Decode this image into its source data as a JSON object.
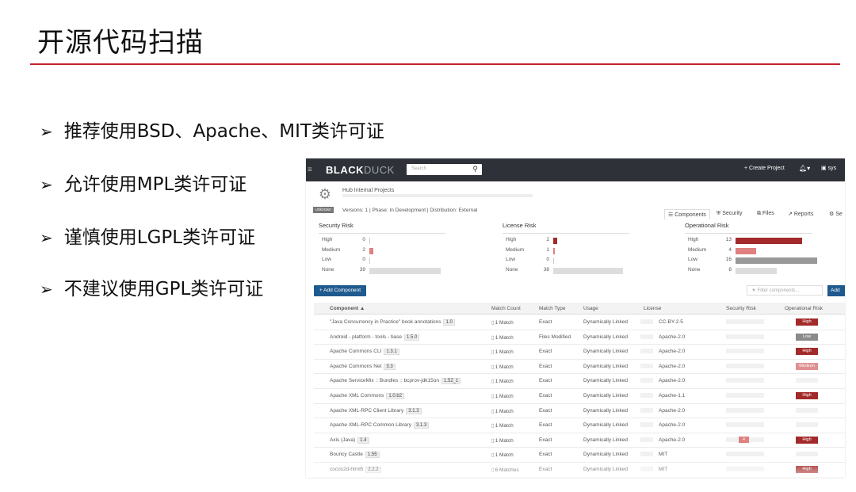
{
  "slide": {
    "title": "开源代码扫描",
    "bullets": [
      {
        "marker": "➢",
        "text": "推荐使用BSD、Apache、MIT类许可证"
      },
      {
        "marker": "➢",
        "text": "允许使用MPL类许可证"
      },
      {
        "marker": "➢",
        "text": "谨慎使用LGPL类许可证"
      },
      {
        "marker": "➢",
        "text": "不建议使用GPL类许可证"
      }
    ],
    "accent_color": "#c8202c"
  },
  "app": {
    "logo_black": "BLACK",
    "logo_duck": "DUCK",
    "search_placeholder": "Search",
    "create_project": "+ Create Project",
    "user": "sys",
    "project": {
      "name": "Hub Internal Projects",
      "badge": "unknown",
      "meta": "Versions: 1  |  Phase: In Development  |  Distribution: External"
    },
    "tabs": [
      "Components",
      "Security",
      "Files",
      "Reports",
      "Se"
    ],
    "risk_panels": [
      {
        "title": "Security Risk",
        "rows": [
          {
            "label": "High",
            "count": 0,
            "color": "#a32a2a"
          },
          {
            "label": "Medium",
            "count": 2,
            "color": "#e08080"
          },
          {
            "label": "Low",
            "count": 0,
            "color": "#999999"
          },
          {
            "label": "None",
            "count": 39,
            "color": "#dddddd"
          }
        ]
      },
      {
        "title": "License Risk",
        "rows": [
          {
            "label": "High",
            "count": 2,
            "color": "#a32a2a"
          },
          {
            "label": "Medium",
            "count": 1,
            "color": "#e08080"
          },
          {
            "label": "Low",
            "count": 0,
            "color": "#999999"
          },
          {
            "label": "None",
            "count": 38,
            "color": "#dddddd"
          }
        ]
      },
      {
        "title": "Operational Risk",
        "rows": [
          {
            "label": "High",
            "count": 13,
            "color": "#a32a2a"
          },
          {
            "label": "Medium",
            "count": 4,
            "color": "#e08080"
          },
          {
            "label": "Low",
            "count": 16,
            "color": "#999999"
          },
          {
            "label": "None",
            "count": 8,
            "color": "#dddddd"
          }
        ]
      }
    ],
    "add_component": "+ Add Component",
    "filter_placeholder": "Filter components...",
    "add_label": "Add",
    "columns": [
      "Component ▲",
      "Match Count",
      "Match Type",
      "Usage",
      "License",
      "Security Risk",
      "Operational Risk"
    ],
    "rows": [
      {
        "component": "\"Java Concurrency in Practice\" book annotations",
        "version": "1.0",
        "match_count": "1 Match",
        "match_type": "Exact",
        "usage": "Dynamically Linked",
        "license": "CC-BY-2.5",
        "security": "",
        "operational": "High"
      },
      {
        "component": "Android - platform - tools - base",
        "version": "1.5.0",
        "match_count": "1 Match",
        "match_type": "Files Modified",
        "usage": "Dynamically Linked",
        "license": "Apache-2.0",
        "security": "",
        "operational": "Low"
      },
      {
        "component": "Apache Commons CLI",
        "version": "1.3.1",
        "match_count": "1 Match",
        "match_type": "Exact",
        "usage": "Dynamically Linked",
        "license": "Apache-2.0",
        "security": "",
        "operational": "High"
      },
      {
        "component": "Apache Commons Net",
        "version": "3.3",
        "match_count": "1 Match",
        "match_type": "Exact",
        "usage": "Dynamically Linked",
        "license": "Apache-2.0",
        "security": "",
        "operational": "Medium"
      },
      {
        "component": "Apache ServiceMix :: Bundles :: bcprov-jdk15on",
        "version": "1.52_1",
        "match_count": "1 Match",
        "match_type": "Exact",
        "usage": "Dynamically Linked",
        "license": "Apache-2.0",
        "security": "",
        "operational": ""
      },
      {
        "component": "Apache XML Commons",
        "version": "1.0.b2",
        "match_count": "1 Match",
        "match_type": "Exact",
        "usage": "Dynamically Linked",
        "license": "Apache-1.1",
        "security": "",
        "operational": "High"
      },
      {
        "component": "Apache XML-RPC Client Library",
        "version": "3.1.3",
        "match_count": "1 Match",
        "match_type": "Exact",
        "usage": "Dynamically Linked",
        "license": "Apache-2.0",
        "security": "",
        "operational": ""
      },
      {
        "component": "Apache XML-RPC Common Library",
        "version": "3.1.3",
        "match_count": "1 Match",
        "match_type": "Exact",
        "usage": "Dynamically Linked",
        "license": "Apache-2.0",
        "security": "",
        "operational": ""
      },
      {
        "component": "Axis (Java)",
        "version": "1.4",
        "match_count": "1 Match",
        "match_type": "Exact",
        "usage": "Dynamically Linked",
        "license": "Apache-2.0",
        "security": "4",
        "operational": "High"
      },
      {
        "component": "Bouncy Castle",
        "version": "1.55",
        "match_count": "1 Match",
        "match_type": "Exact",
        "usage": "Dynamically Linked",
        "license": "MIT",
        "security": "",
        "operational": ""
      },
      {
        "component": "cocos2d-html5",
        "version": "2.2.2",
        "match_count": "6 Matches",
        "match_type": "Exact",
        "usage": "Dynamically Linked",
        "license": "MIT",
        "security": "",
        "operational": "High"
      }
    ],
    "chip_colors": {
      "High": "#a32a2a",
      "Medium": "#e09090",
      "Low": "#8a8a8a",
      "security": "#e08080"
    }
  }
}
